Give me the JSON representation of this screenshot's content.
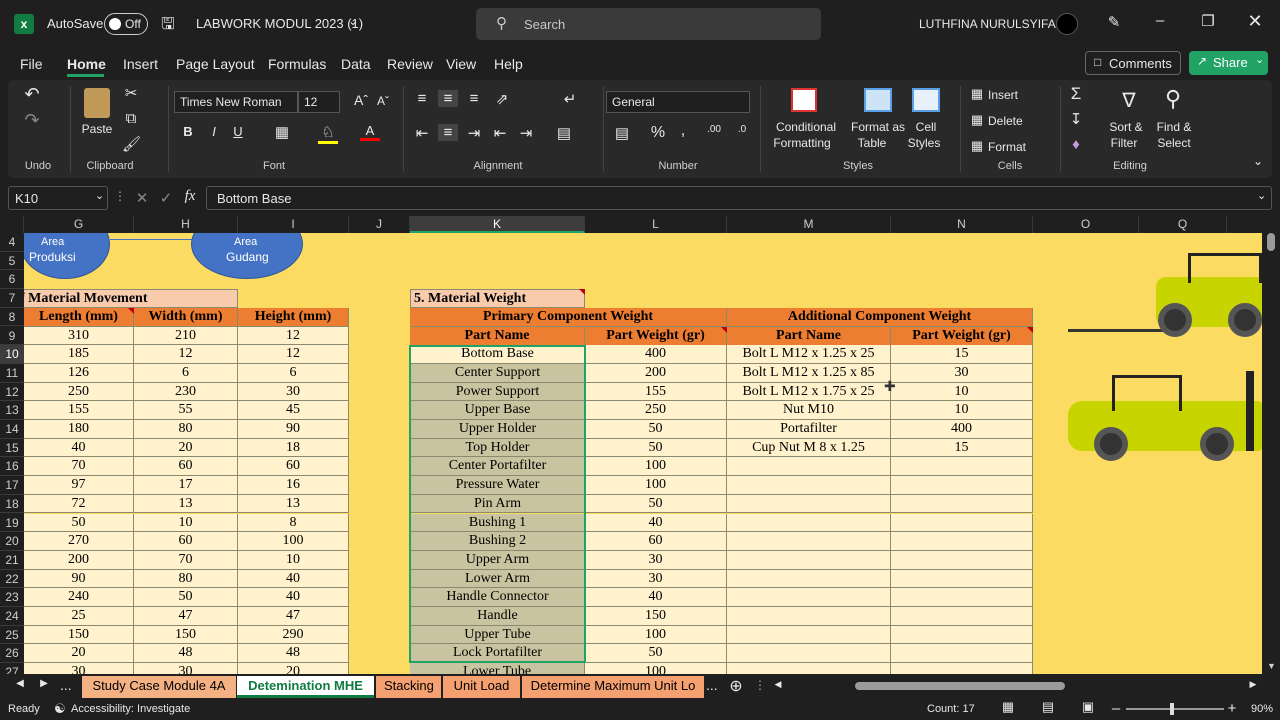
{
  "titlebar": {
    "autosave_label": "AutoSave",
    "autosave_state": "Off",
    "filename": "LABWORK MODUL 2023 (1)",
    "search_placeholder": "Search",
    "user_name": "LUTHFINA NURULSYIFA"
  },
  "menu": {
    "items": [
      "File",
      "Home",
      "Insert",
      "Page Layout",
      "Formulas",
      "Data",
      "Review",
      "View",
      "Help"
    ],
    "active": "Home",
    "comments_label": "Comments",
    "share_label": "Share"
  },
  "ribbon": {
    "undo_group": "Undo",
    "clipboard_group": "Clipboard",
    "paste_label": "Paste",
    "font_group": "Font",
    "font_name": "Times New Roman",
    "font_size": "12",
    "alignment_group": "Alignment",
    "number_group": "Number",
    "number_format": "General",
    "styles_group": "Styles",
    "conditional_formatting": [
      "Conditional",
      "Formatting"
    ],
    "format_as_table": [
      "Format as",
      "Table"
    ],
    "cell_styles": [
      "Cell",
      "Styles"
    ],
    "cells_group": "Cells",
    "insert_label": "Insert",
    "delete_label": "Delete",
    "format_label": "Format",
    "editing_group": "Editing",
    "sort_filter": [
      "Sort &",
      "Filter"
    ],
    "find_select": [
      "Find &",
      "Select"
    ],
    "bold": "B",
    "italic": "I",
    "underline": "U"
  },
  "formula_bar": {
    "name_box": "K10",
    "fx": "fx",
    "content": "Bottom Base"
  },
  "columns": [
    "G",
    "H",
    "I",
    "J",
    "K",
    "L",
    "M",
    "N",
    "O",
    "Q"
  ],
  "rows": [
    "4",
    "5",
    "6",
    "7",
    "8",
    "9",
    "10",
    "11",
    "12",
    "13",
    "14",
    "15",
    "16",
    "17",
    "18",
    "19",
    "20",
    "21",
    "22",
    "23",
    "24",
    "25",
    "26",
    "27"
  ],
  "diagram": {
    "left_circle": [
      "Area",
      "Produksi"
    ],
    "right_circle": [
      "Area",
      "Gudang"
    ]
  },
  "movement": {
    "section_title": "f Material Movement",
    "headers": [
      "Length (mm)",
      "Width (mm)",
      "Height  (mm)"
    ],
    "rows": [
      [
        "310",
        "210",
        "12"
      ],
      [
        "185",
        "12",
        "12"
      ],
      [
        "126",
        "6",
        "6"
      ],
      [
        "250",
        "230",
        "30"
      ],
      [
        "155",
        "55",
        "45"
      ],
      [
        "180",
        "80",
        "90"
      ],
      [
        "40",
        "20",
        "18"
      ],
      [
        "70",
        "60",
        "60"
      ],
      [
        "97",
        "17",
        "16"
      ],
      [
        "72",
        "13",
        "13"
      ],
      [
        "50",
        "10",
        "8"
      ],
      [
        "270",
        "60",
        "100"
      ],
      [
        "200",
        "70",
        "10"
      ],
      [
        "90",
        "80",
        "40"
      ],
      [
        "240",
        "50",
        "40"
      ],
      [
        "25",
        "47",
        "47"
      ],
      [
        "150",
        "150",
        "290"
      ],
      [
        "20",
        "48",
        "48"
      ],
      [
        "30",
        "30",
        "20"
      ]
    ]
  },
  "weight": {
    "section_title": "5. Material Weight",
    "primary_title": "Primary Component Weight",
    "additional_title": "Additional Component Weight",
    "col_headers": [
      "Part Name",
      "Part Weight (gr)",
      "Part Name",
      "Part Weight (gr)"
    ],
    "primary_rows": [
      [
        "Bottom Base",
        "400"
      ],
      [
        "Center Support",
        "200"
      ],
      [
        "Power Support",
        "155"
      ],
      [
        "Upper Base",
        "250"
      ],
      [
        "Upper Holder",
        "50"
      ],
      [
        "Top Holder",
        "50"
      ],
      [
        "Center Portafilter",
        "100"
      ],
      [
        "Pressure Water",
        "100"
      ],
      [
        "Pin Arm",
        "50"
      ],
      [
        "Bushing 1",
        "40"
      ],
      [
        "Bushing 2",
        "60"
      ],
      [
        "Upper Arm",
        "30"
      ],
      [
        "Lower Arm",
        "30"
      ],
      [
        "Handle Connector",
        "40"
      ],
      [
        "Handle",
        "150"
      ],
      [
        "Upper Tube",
        "100"
      ],
      [
        "Lock Portafilter",
        "50"
      ],
      [
        "Lower Tube",
        "100"
      ]
    ],
    "additional_rows": [
      [
        "Bolt L M12 x 1.25 x 25",
        "15"
      ],
      [
        "Bolt L M12 x 1.25 x 85",
        "30"
      ],
      [
        "Bolt L M12 x 1.75 x 25",
        "10"
      ],
      [
        "Nut M10",
        "10"
      ],
      [
        "Portafilter",
        "400"
      ],
      [
        "Cup Nut M 8 x 1.25",
        "15"
      ]
    ]
  },
  "sheet_tabs": [
    "...",
    "Study Case Module 4A",
    "Detemination MHE",
    "Stacking",
    "Unit Load",
    "Determine Maximum Unit Lo",
    "..."
  ],
  "active_tab": "Detemination MHE",
  "status": {
    "ready": "Ready",
    "accessibility": "Accessibility: Investigate",
    "count": "Count: 17",
    "zoom": "90%"
  },
  "colors": {
    "sheet_bg": "#fbdb62",
    "header_orange": "#ed7d31",
    "cell_cream": "#fff2cc",
    "selected_gray": "#c9c4a0",
    "accent_green": "#21a366"
  }
}
